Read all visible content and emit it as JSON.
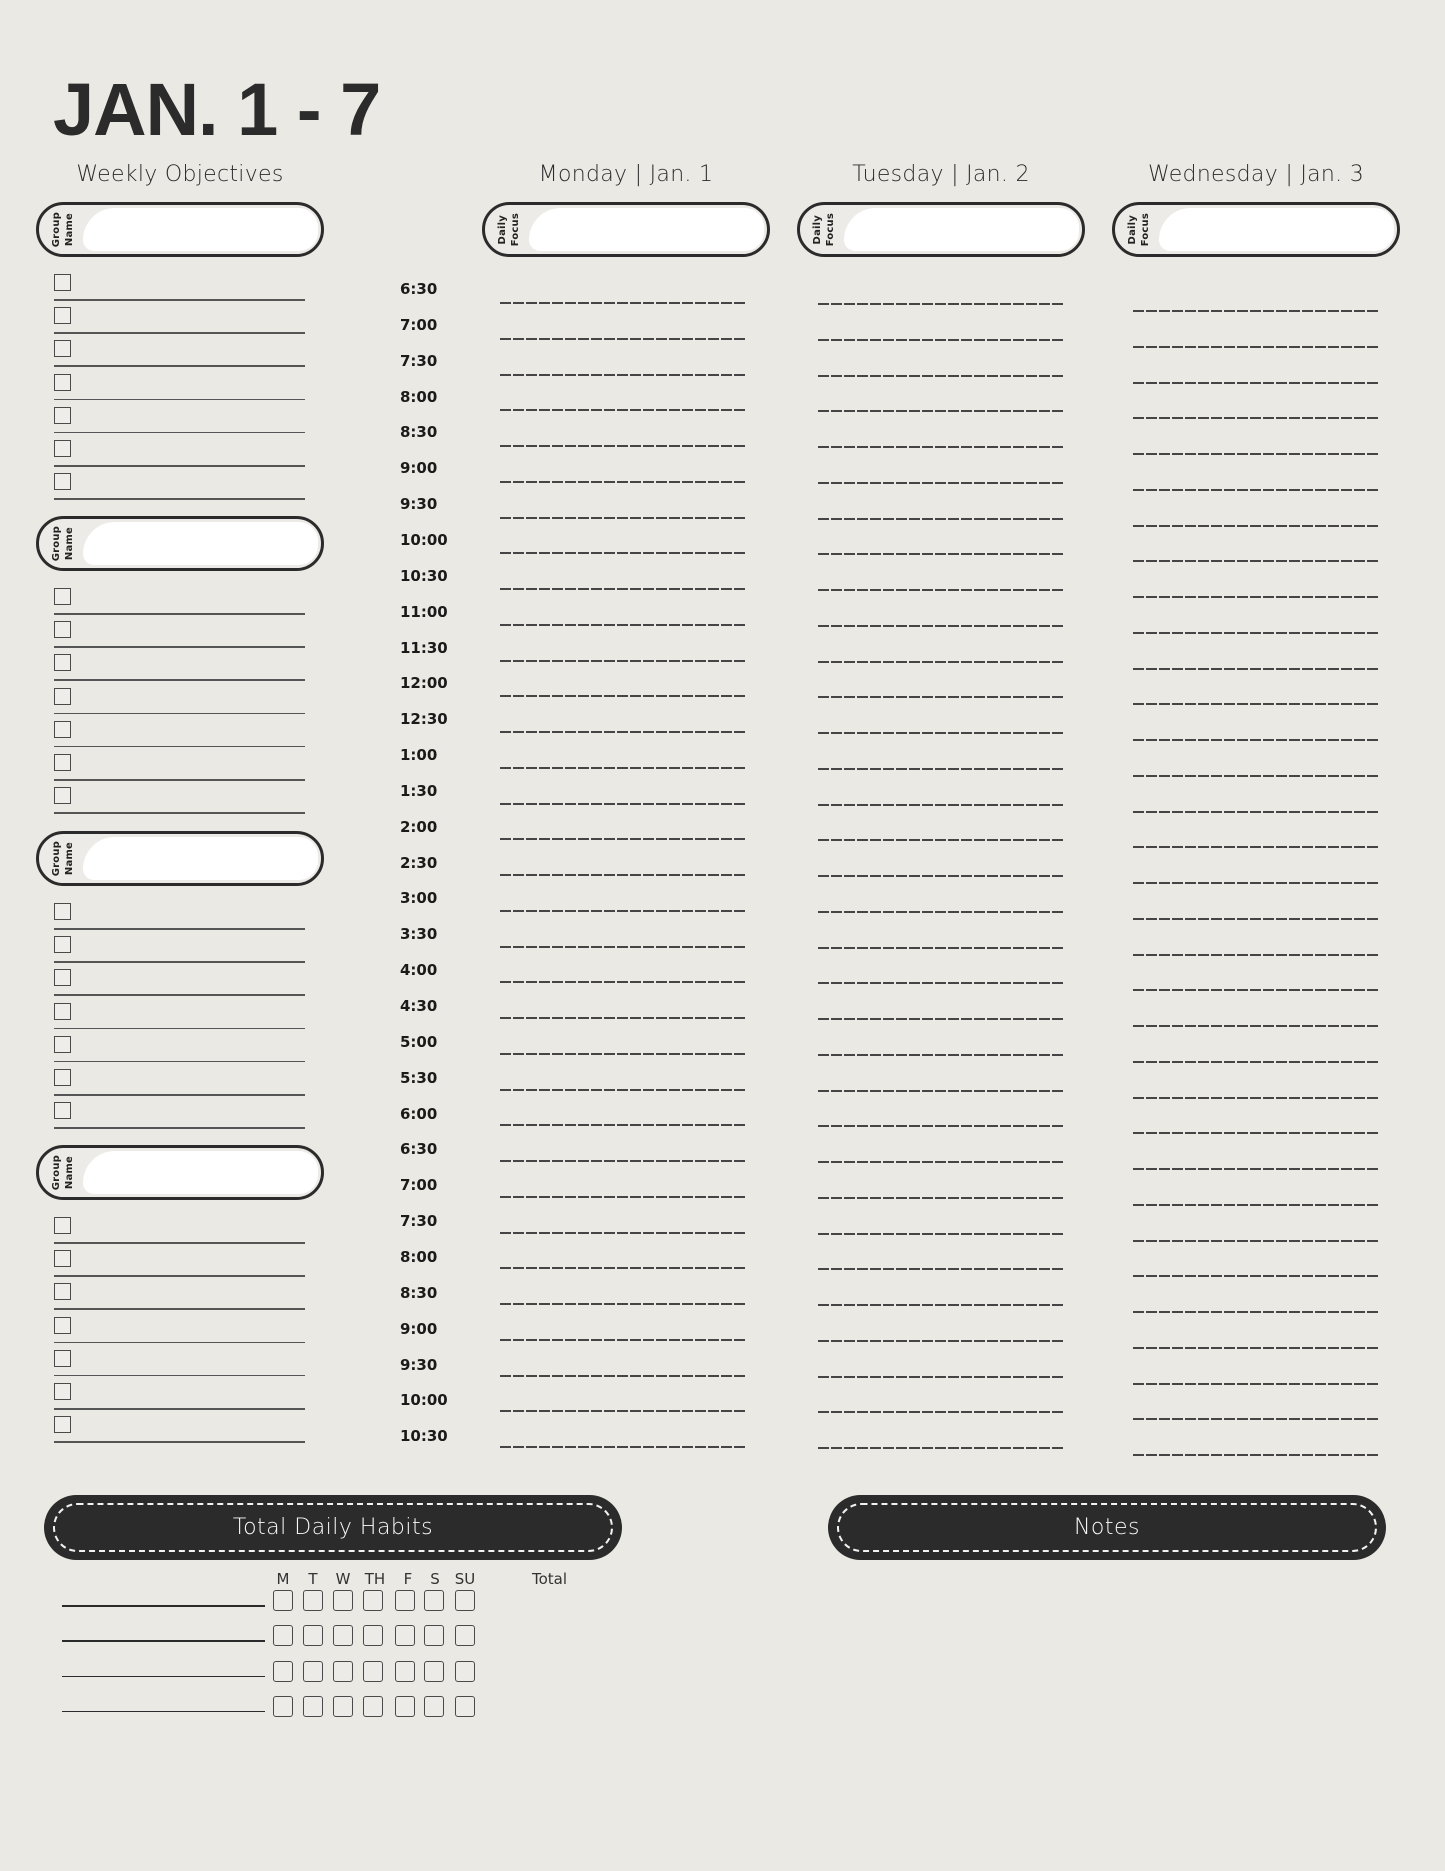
{
  "title": "JAN. 1 - 7",
  "weekly_objectives": {
    "heading": "Weekly Objectives",
    "groups": [
      {
        "label_line1": "Group",
        "label_line2": "Name",
        "value": "",
        "items": 7
      },
      {
        "label_line1": "Group",
        "label_line2": "Name",
        "value": "",
        "items": 7
      },
      {
        "label_line1": "Group",
        "label_line2": "Name",
        "value": "",
        "items": 7
      },
      {
        "label_line1": "Group",
        "label_line2": "Name",
        "value": "",
        "items": 7
      }
    ]
  },
  "days": [
    {
      "heading": "Monday | Jan. 1",
      "focus_line1": "Daily",
      "focus_line2": "Focus",
      "focus_value": ""
    },
    {
      "heading": "Tuesday | Jan. 2",
      "focus_line1": "Daily",
      "focus_line2": "Focus",
      "focus_value": ""
    },
    {
      "heading": "Wednesday | Jan. 3",
      "focus_line1": "Daily",
      "focus_line2": "Focus",
      "focus_value": ""
    }
  ],
  "times": [
    "6:30",
    "7:00",
    "7:30",
    "8:00",
    "8:30",
    "9:00",
    "9:30",
    "10:00",
    "10:30",
    "11:00",
    "11:30",
    "12:00",
    "12:30",
    "1:00",
    "1:30",
    "2:00",
    "2:30",
    "3:00",
    "3:30",
    "4:00",
    "4:30",
    "5:00",
    "5:30",
    "6:00",
    "6:30",
    "7:00",
    "7:30",
    "8:00",
    "8:30",
    "9:00",
    "9:30",
    "10:00",
    "10:30"
  ],
  "habits": {
    "heading": "Total Daily Habits",
    "day_letters": [
      "M",
      "T",
      "W",
      "TH",
      "F",
      "S",
      "SU"
    ],
    "total_label": "Total",
    "rows": 4
  },
  "notes": {
    "heading": "Notes"
  },
  "colors": {
    "background": "#EAE9E4",
    "ink": "#2b2b2b",
    "banner_text": "#fafafa"
  }
}
